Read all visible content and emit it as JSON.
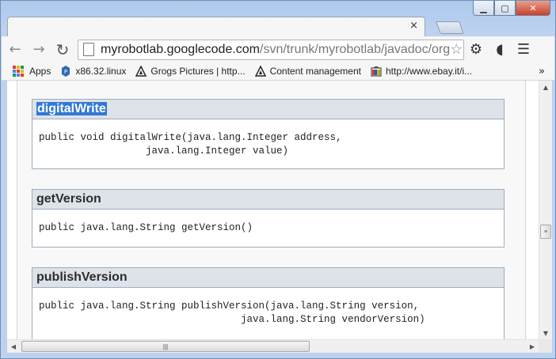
{
  "window": {
    "controls": {
      "minimize": "▁",
      "maximize": "▢",
      "close": "✕"
    }
  },
  "tab": {
    "close_glyph": "×"
  },
  "toolbar": {
    "back_icon": "back-arrow-icon",
    "forward_icon": "forward-arrow-icon",
    "reload_icon": "reload-icon",
    "url_host": "myrobotlab.googlecode.com",
    "url_path": "/svn/trunk/myrobotlab/javadoc/org",
    "star_glyph": "☆",
    "settings_glyph": "⚙",
    "extension_glyph": "◖",
    "menu_glyph": "☰"
  },
  "bookmarks": {
    "items": [
      {
        "label": "Apps",
        "icon": "apps-grid-icon"
      },
      {
        "label": "x86.32.linux",
        "icon": "bookmark-favicon-icon"
      },
      {
        "label": "Grogs Pictures | http...",
        "icon": "construction-sign-icon"
      },
      {
        "label": "Content management",
        "icon": "construction-sign-icon"
      },
      {
        "label": "http://www.ebay.it/i...",
        "icon": "ebay-icon"
      }
    ],
    "more_glyph": "»"
  },
  "methods": [
    {
      "name": "digitalWrite",
      "selected": true,
      "signature": "public void digitalWrite(java.lang.Integer address,\n                  java.lang.Integer value)"
    },
    {
      "name": "getVersion",
      "selected": false,
      "signature": "public java.lang.String getVersion()"
    },
    {
      "name": "publishVersion",
      "selected": false,
      "signature": "public java.lang.String publishVersion(java.lang.String version,\n                                  java.lang.String vendorVersion)"
    }
  ],
  "scrollbars": {
    "up": "▲",
    "down": "▼",
    "left": "◀",
    "right": "▶",
    "grip_v": "≡",
    "grip_h": "|||"
  },
  "colors": {
    "accent_selection": "#3478d6",
    "method_header_bg": "#dee3e9",
    "window_frame": "#aec9ec"
  }
}
